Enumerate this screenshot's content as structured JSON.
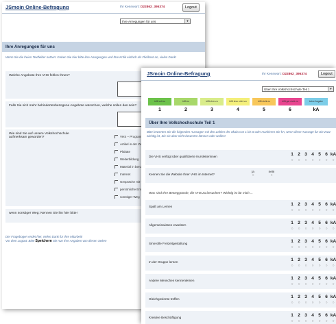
{
  "back_window": {
    "title": "JSmoin Online-Befragung",
    "kennwort_label": "Ihr Kennwort:",
    "kennwort_value": "D22862_395374",
    "logout_label": "Logout",
    "section_select": "Ihre Anregungen für uns",
    "section_title": "Ihre Anregungen für uns",
    "intro": "Wenn Sie die freien Textfelder nutzen: Geben Sie hier bitte ihre Anregungen und Ihre Kritik einfach als Fließtext an, vielen Dank!",
    "q1": "Welche Angebote Ihre VHS fehlen Ihnen?",
    "q2": "Falls Sie sich mehr behindertenbezogene Angebote wünschen, welche sollen das sein?",
    "q3": "Wie sind Sie auf unsere Volkshochschule aufmerksam geworden?",
    "checkbox_options": [
      "VHS – Programm",
      "Artikel in der Zeitung",
      "Plakate",
      "Weiterbildung",
      "Material in berufl.",
      "Internet",
      "Gespräche mit Verwandten",
      "persönliche Empfehlung",
      "sonstiger Weg"
    ],
    "q4": "wenn sonstiger Weg: Nennen Sie ihn hier bitte!",
    "footer_line1": "Der Fragebogen endet hier, vielen Dank für Ihre Mitarbeit!",
    "footer_line2_pre": "Vor dem Logout: Bitte",
    "footer_save": "Speichern",
    "footer_line2_post": "Sie nun Ihre Angaben von diesen Seiten"
  },
  "front_window": {
    "title": "JSmoin Online-Befragung",
    "kennwort_label": "Ihr Kennwort:",
    "kennwort_value": "D22862_395374",
    "logout_label": "Logout",
    "section_select": "Über Ihre Volkshochschule Teil 1",
    "section_title": "Über Ihre Volkshochschule Teil 1",
    "intro": "Bitte bewerten Sie die folgenden Aussagen mit den Zahlen der Skala von 1 bis 6 oder markieren Sie kA, wenn diese Aussage für Sie zwar wichtig ist, Sie sie aber nicht bewerten können oder wollen!",
    "scale": [
      {
        "label": "trifft voll zu",
        "num": "1",
        "color": "#6cc24a"
      },
      {
        "label": "trifft zu",
        "num": "2",
        "color": "#a8d86a"
      },
      {
        "label": "trifft eher zu",
        "num": "3",
        "color": "#d9ec8a"
      },
      {
        "label": "trifft eher nicht zu",
        "num": "4",
        "color": "#f4ef7a"
      },
      {
        "label": "trifft nicht zu",
        "num": "5",
        "color": "#f8c75a"
      },
      {
        "label": "trifft gar nicht zu",
        "num": "6",
        "color": "#e8458f"
      },
      {
        "label": "keine Angabe",
        "num": "kA",
        "color": "#7ccde8"
      }
    ],
    "q_vhs": "Die VHS verfügt über qualifizierte Kursleiterinnen",
    "q_website": "Kennen Sie die Website Ihrer VHS im Internet?",
    "ja": "ja",
    "nein": "nein",
    "motives_heading": "Was sind Ihre Beweggründe, die VHS zu besuchen? Wichtig ist für mich ...",
    "items": [
      "Spaß am Lernen",
      "Allgemeinwissen erweitern",
      "Sinnvolle Freizeitgestaltung",
      "In der Gruppe lernen",
      "Andere Menschen kennenlernen",
      "Gleichgesinnte treffen",
      "Kreative Beschäftigung"
    ],
    "nums": [
      "1",
      "2",
      "3",
      "4",
      "5",
      "6",
      "kA"
    ],
    "radio": "○"
  }
}
